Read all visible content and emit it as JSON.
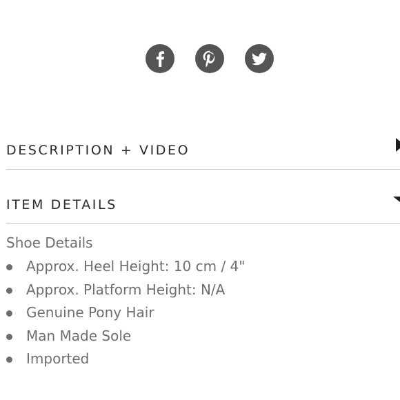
{
  "social": {
    "icons": [
      "facebook-icon",
      "pinterest-icon",
      "twitter-icon"
    ],
    "color": "#555555"
  },
  "accordion": {
    "description_title": "DESCRIPTION + VIDEO",
    "item_details_title": "ITEM DETAILS",
    "description_state": "collapsed",
    "item_details_state": "expanded"
  },
  "details": {
    "heading": "Shoe Details",
    "items": [
      "Approx. Heel Height: 10 cm / 4\"",
      "Approx. Platform Height: N/A",
      "Genuine Pony Hair",
      "Man Made Sole",
      "Imported"
    ]
  }
}
